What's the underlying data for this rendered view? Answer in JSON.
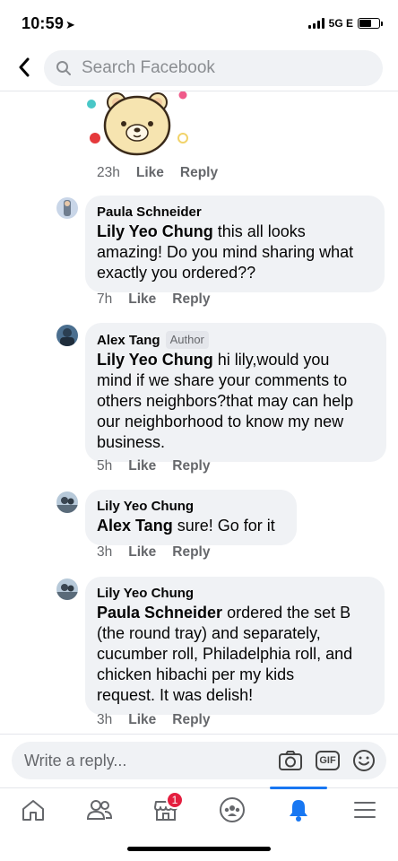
{
  "status_bar": {
    "time": "10:59",
    "network": "5G E"
  },
  "search": {
    "placeholder": "Search Facebook"
  },
  "comments": [
    {
      "author": "",
      "time": "23h",
      "like": "Like",
      "reply": "Reply",
      "has_sticker": true
    },
    {
      "author": "Paula Schneider",
      "mention": "Lily Yeo Chung",
      "text_lines": [
        " this all looks",
        "amazing! Do you mind sharing what",
        "exactly you ordered??"
      ],
      "time": "7h",
      "like": "Like",
      "reply": "Reply"
    },
    {
      "author": "Alex Tang",
      "badge": "Author",
      "mention": "Lily Yeo Chung",
      "text_lines": [
        " hi lily,would you",
        "mind if we share your comments to",
        "others neighbors?that may can help",
        "our neighborhood to know my new",
        "business."
      ],
      "time": "5h",
      "like": "Like",
      "reply": "Reply"
    },
    {
      "author": "Lily Yeo Chung",
      "mention": "Alex Tang",
      "text_lines": [
        " sure! Go for it"
      ],
      "time": "3h",
      "like": "Like",
      "reply": "Reply"
    },
    {
      "author": "Lily Yeo Chung",
      "mention": "Paula Schneider",
      "text_lines": [
        " ordered the set B",
        "(the round tray) and separately,",
        "cucumber roll, Philadelphia roll, and",
        "chicken hibachi per my kids",
        "request. It was delish!"
      ],
      "time": "3h",
      "like": "Like",
      "reply": "Reply"
    }
  ],
  "reply_input": {
    "placeholder": "Write a reply...",
    "gif_label": "GIF"
  },
  "bottom_nav": {
    "items": [
      "home-icon",
      "friends-icon",
      "marketplace-icon",
      "groups-icon",
      "notifications-icon",
      "menu-icon"
    ],
    "marketplace_badge": "1",
    "active": "notifications-icon"
  },
  "colors": {
    "accent": "#1877f2",
    "badge": "#e41e3f",
    "bubble": "#f0f2f5"
  }
}
